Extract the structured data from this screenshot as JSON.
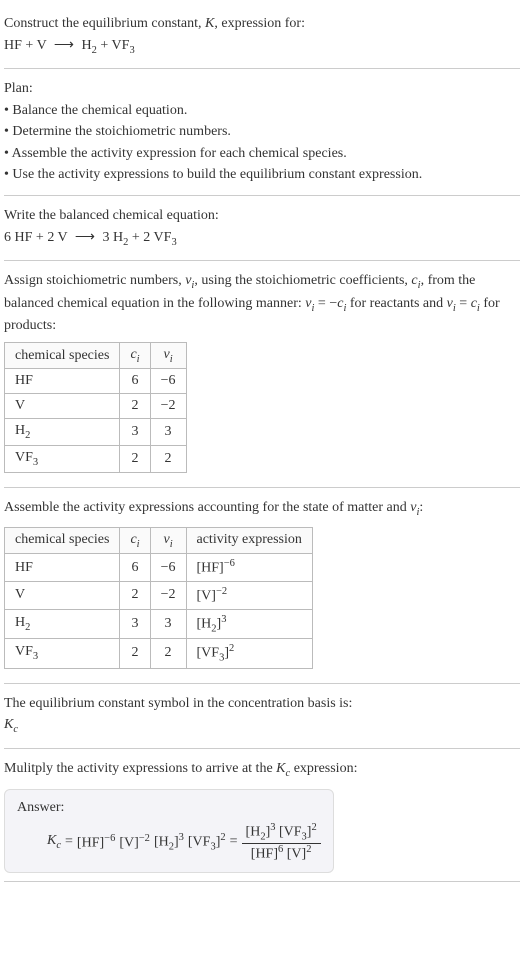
{
  "intro": {
    "line1_pre": "Construct the equilibrium constant, ",
    "line1_k": "K",
    "line1_post": ", expression for:",
    "eq_lhs_a": "HF",
    "eq_plus": " + ",
    "eq_lhs_b": "V",
    "eq_arrow": "⟶",
    "eq_rhs_a": "H",
    "eq_rhs_a_sub": "2",
    "eq_rhs_b": "VF",
    "eq_rhs_b_sub": "3"
  },
  "plan": {
    "title": "Plan:",
    "b1": "• Balance the chemical equation.",
    "b2": "• Determine the stoichiometric numbers.",
    "b3": "• Assemble the activity expression for each chemical species.",
    "b4": "• Use the activity expressions to build the equilibrium constant expression."
  },
  "balanced": {
    "title": "Write the balanced chemical equation:",
    "c1": "6 HF",
    "c2": "2 V",
    "c3": "3 H",
    "c3_sub": "2",
    "c4": "2 VF",
    "c4_sub": "3",
    "plus": " + ",
    "arrow": "⟶"
  },
  "stoich": {
    "text_a": "Assign stoichiometric numbers, ",
    "nu": "ν",
    "nu_sub": "i",
    "text_b": ", using the stoichiometric coefficients, ",
    "c": "c",
    "c_sub": "i",
    "text_c": ", from the balanced chemical equation in the following manner: ",
    "rel1_a": "ν",
    "rel1_b": " = −",
    "rel1_c": "c",
    "text_d": " for reactants and ",
    "rel2_a": "ν",
    "rel2_b": " = ",
    "rel2_c": "c",
    "text_e": " for products:",
    "h1": "chemical species",
    "h2": "c",
    "h2_sub": "i",
    "h3": "ν",
    "h3_sub": "i",
    "r1a": "HF",
    "r1b": "6",
    "r1c": "−6",
    "r2a": "V",
    "r2b": "2",
    "r2c": "−2",
    "r3a": "H",
    "r3a_sub": "2",
    "r3b": "3",
    "r3c": "3",
    "r4a": "VF",
    "r4a_sub": "3",
    "r4b": "2",
    "r4c": "2"
  },
  "activity": {
    "text_a": "Assemble the activity expressions accounting for the state of matter and ",
    "nu": "ν",
    "nu_sub": "i",
    "text_b": ":",
    "h1": "chemical species",
    "h2": "c",
    "h2_sub": "i",
    "h3": "ν",
    "h3_sub": "i",
    "h4": "activity expression",
    "r1a": "HF",
    "r1b": "6",
    "r1c": "−6",
    "r1d_base": "[HF]",
    "r1d_exp": "−6",
    "r2a": "V",
    "r2b": "2",
    "r2c": "−2",
    "r2d_base": "[V]",
    "r2d_exp": "−2",
    "r3a": "H",
    "r3a_sub": "2",
    "r3b": "3",
    "r3c": "3",
    "r3d_base_a": "[H",
    "r3d_base_sub": "2",
    "r3d_base_b": "]",
    "r3d_exp": "3",
    "r4a": "VF",
    "r4a_sub": "3",
    "r4b": "2",
    "r4c": "2",
    "r4d_base_a": "[VF",
    "r4d_base_sub": "3",
    "r4d_base_b": "]",
    "r4d_exp": "2"
  },
  "basis": {
    "text": "The equilibrium constant symbol in the concentration basis is:",
    "k": "K",
    "k_sub": "c"
  },
  "final": {
    "text_a": "Mulitply the activity expressions to arrive at the ",
    "k": "K",
    "k_sub": "c",
    "text_b": " expression:",
    "answer": "Answer:",
    "lhs_k": "K",
    "lhs_k_sub": "c",
    "eq": " = ",
    "t1": "[HF]",
    "t1e": "−6",
    "t2": "[V]",
    "t2e": "−2",
    "t3a": "[H",
    "t3s": "2",
    "t3b": "]",
    "t3e": "3",
    "t4a": "[VF",
    "t4s": "3",
    "t4b": "]",
    "t4e": "2",
    "eq2": " = ",
    "num_a": "[H",
    "num_as": "2",
    "num_ab": "]",
    "num_ae": "3",
    "num_b": "[VF",
    "num_bs": "3",
    "num_bb": "]",
    "num_be": "2",
    "den_a": "[HF]",
    "den_ae": "6",
    "den_b": "[V]",
    "den_be": "2"
  }
}
